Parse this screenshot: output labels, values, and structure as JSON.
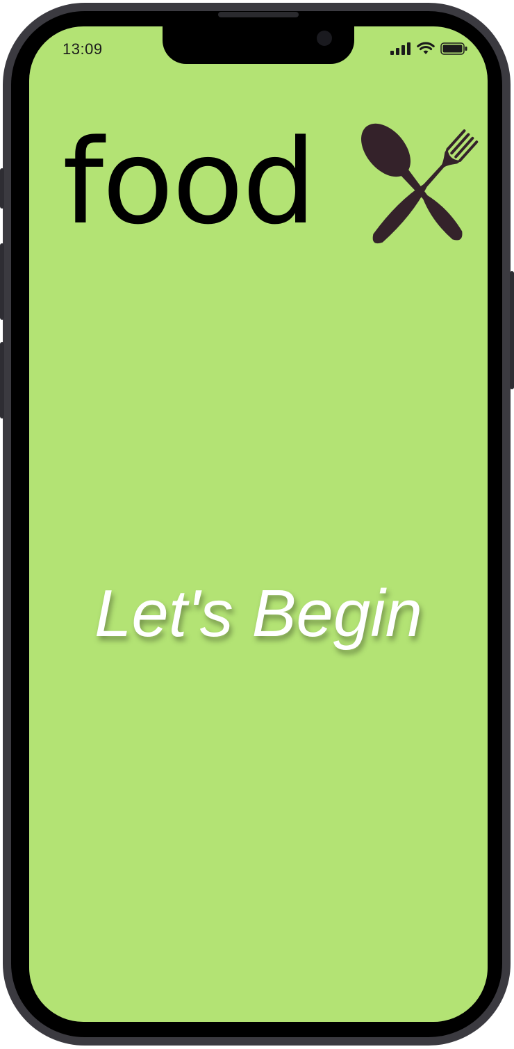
{
  "status_bar": {
    "time": "13:09"
  },
  "logo": {
    "text": "food",
    "icon": "spoon-fork-crossed-icon"
  },
  "headline": "Let's Begin",
  "colors": {
    "screen_background": "#b3e374",
    "logo_icon": "#34222a",
    "frame": "#3b3a40"
  }
}
